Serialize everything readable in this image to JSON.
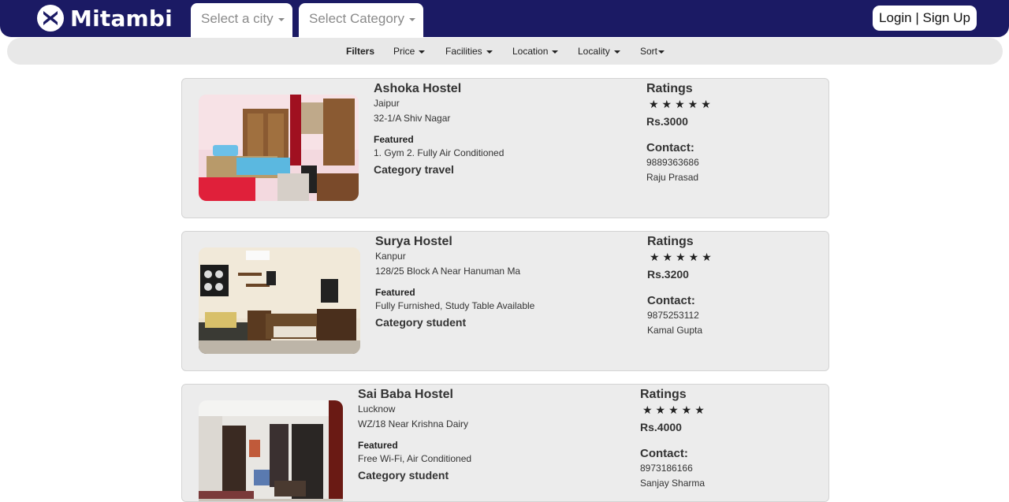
{
  "header": {
    "brand": "Mitambi",
    "city_select": "Select a city",
    "category_select": "Select Category",
    "login_label": "Login | Sign Up",
    "colors": {
      "header_bg": "#1b1a64",
      "filter_bar_bg": "#e8e8e8",
      "card_bg": "#ececec"
    }
  },
  "filters": {
    "title": "Filters",
    "items": [
      "Price",
      "Facilities",
      "Location",
      "Locality",
      "Sort"
    ]
  },
  "listings": [
    {
      "name": "Ashoka Hostel",
      "city": "Jaipur",
      "address": "32-1/A Shiv Nagar",
      "featured_label": "Featured",
      "features": "1. Gym 2. Fully Air Conditioned",
      "category": "Category travel",
      "ratings_label": "Ratings",
      "rating": 5,
      "stars": "★★★★★",
      "price": "Rs.3000",
      "contact_label": "Contact:",
      "phone": "9889363686",
      "contact_name": "Raju Prasad",
      "image_icon": "hostel-room-photo"
    },
    {
      "name": "Surya Hostel",
      "city": "Kanpur",
      "address": "128/25 Block A Near Hanuman Ma",
      "featured_label": "Featured",
      "features": "Fully Furnished, Study Table Available",
      "category": "Category student",
      "ratings_label": "Ratings",
      "rating": 5,
      "stars": "★★★★★",
      "price": "Rs.3200",
      "contact_label": "Contact:",
      "phone": "9875253112",
      "contact_name": "Kamal Gupta",
      "image_icon": "hostel-room-photo"
    },
    {
      "name": "Sai Baba Hostel",
      "city": "Lucknow",
      "address": "WZ/18 Near Krishna Dairy",
      "featured_label": "Featured",
      "features": "Free Wi-Fi, Air Conditioned",
      "category": "Category student",
      "ratings_label": "Ratings",
      "rating": 5,
      "stars": "★★★★★",
      "price": "Rs.4000",
      "contact_label": "Contact:",
      "phone": "8973186166",
      "contact_name": "Sanjay Sharma",
      "image_icon": "hostel-room-photo"
    }
  ]
}
